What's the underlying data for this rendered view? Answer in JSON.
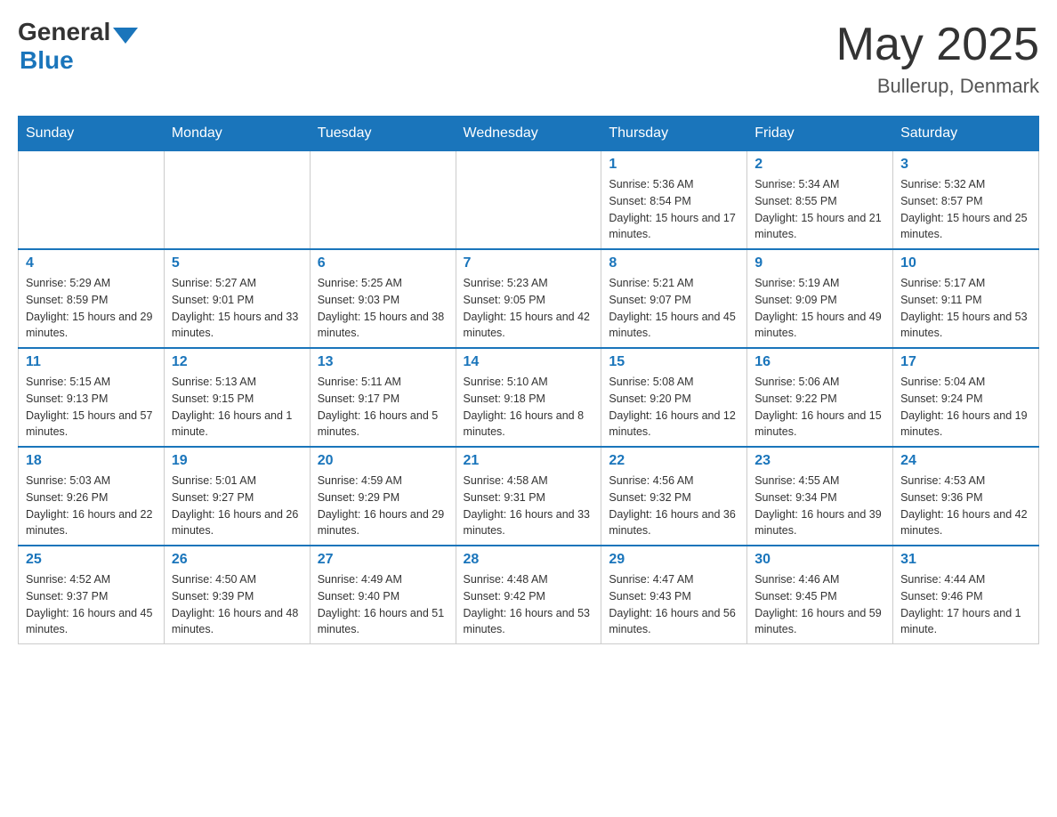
{
  "header": {
    "logo_general": "General",
    "logo_blue": "Blue",
    "month_year": "May 2025",
    "location": "Bullerup, Denmark"
  },
  "days_of_week": [
    "Sunday",
    "Monday",
    "Tuesday",
    "Wednesday",
    "Thursday",
    "Friday",
    "Saturday"
  ],
  "weeks": [
    [
      {
        "day": "",
        "info": ""
      },
      {
        "day": "",
        "info": ""
      },
      {
        "day": "",
        "info": ""
      },
      {
        "day": "",
        "info": ""
      },
      {
        "day": "1",
        "info": "Sunrise: 5:36 AM\nSunset: 8:54 PM\nDaylight: 15 hours and 17 minutes."
      },
      {
        "day": "2",
        "info": "Sunrise: 5:34 AM\nSunset: 8:55 PM\nDaylight: 15 hours and 21 minutes."
      },
      {
        "day": "3",
        "info": "Sunrise: 5:32 AM\nSunset: 8:57 PM\nDaylight: 15 hours and 25 minutes."
      }
    ],
    [
      {
        "day": "4",
        "info": "Sunrise: 5:29 AM\nSunset: 8:59 PM\nDaylight: 15 hours and 29 minutes."
      },
      {
        "day": "5",
        "info": "Sunrise: 5:27 AM\nSunset: 9:01 PM\nDaylight: 15 hours and 33 minutes."
      },
      {
        "day": "6",
        "info": "Sunrise: 5:25 AM\nSunset: 9:03 PM\nDaylight: 15 hours and 38 minutes."
      },
      {
        "day": "7",
        "info": "Sunrise: 5:23 AM\nSunset: 9:05 PM\nDaylight: 15 hours and 42 minutes."
      },
      {
        "day": "8",
        "info": "Sunrise: 5:21 AM\nSunset: 9:07 PM\nDaylight: 15 hours and 45 minutes."
      },
      {
        "day": "9",
        "info": "Sunrise: 5:19 AM\nSunset: 9:09 PM\nDaylight: 15 hours and 49 minutes."
      },
      {
        "day": "10",
        "info": "Sunrise: 5:17 AM\nSunset: 9:11 PM\nDaylight: 15 hours and 53 minutes."
      }
    ],
    [
      {
        "day": "11",
        "info": "Sunrise: 5:15 AM\nSunset: 9:13 PM\nDaylight: 15 hours and 57 minutes."
      },
      {
        "day": "12",
        "info": "Sunrise: 5:13 AM\nSunset: 9:15 PM\nDaylight: 16 hours and 1 minute."
      },
      {
        "day": "13",
        "info": "Sunrise: 5:11 AM\nSunset: 9:17 PM\nDaylight: 16 hours and 5 minutes."
      },
      {
        "day": "14",
        "info": "Sunrise: 5:10 AM\nSunset: 9:18 PM\nDaylight: 16 hours and 8 minutes."
      },
      {
        "day": "15",
        "info": "Sunrise: 5:08 AM\nSunset: 9:20 PM\nDaylight: 16 hours and 12 minutes."
      },
      {
        "day": "16",
        "info": "Sunrise: 5:06 AM\nSunset: 9:22 PM\nDaylight: 16 hours and 15 minutes."
      },
      {
        "day": "17",
        "info": "Sunrise: 5:04 AM\nSunset: 9:24 PM\nDaylight: 16 hours and 19 minutes."
      }
    ],
    [
      {
        "day": "18",
        "info": "Sunrise: 5:03 AM\nSunset: 9:26 PM\nDaylight: 16 hours and 22 minutes."
      },
      {
        "day": "19",
        "info": "Sunrise: 5:01 AM\nSunset: 9:27 PM\nDaylight: 16 hours and 26 minutes."
      },
      {
        "day": "20",
        "info": "Sunrise: 4:59 AM\nSunset: 9:29 PM\nDaylight: 16 hours and 29 minutes."
      },
      {
        "day": "21",
        "info": "Sunrise: 4:58 AM\nSunset: 9:31 PM\nDaylight: 16 hours and 33 minutes."
      },
      {
        "day": "22",
        "info": "Sunrise: 4:56 AM\nSunset: 9:32 PM\nDaylight: 16 hours and 36 minutes."
      },
      {
        "day": "23",
        "info": "Sunrise: 4:55 AM\nSunset: 9:34 PM\nDaylight: 16 hours and 39 minutes."
      },
      {
        "day": "24",
        "info": "Sunrise: 4:53 AM\nSunset: 9:36 PM\nDaylight: 16 hours and 42 minutes."
      }
    ],
    [
      {
        "day": "25",
        "info": "Sunrise: 4:52 AM\nSunset: 9:37 PM\nDaylight: 16 hours and 45 minutes."
      },
      {
        "day": "26",
        "info": "Sunrise: 4:50 AM\nSunset: 9:39 PM\nDaylight: 16 hours and 48 minutes."
      },
      {
        "day": "27",
        "info": "Sunrise: 4:49 AM\nSunset: 9:40 PM\nDaylight: 16 hours and 51 minutes."
      },
      {
        "day": "28",
        "info": "Sunrise: 4:48 AM\nSunset: 9:42 PM\nDaylight: 16 hours and 53 minutes."
      },
      {
        "day": "29",
        "info": "Sunrise: 4:47 AM\nSunset: 9:43 PM\nDaylight: 16 hours and 56 minutes."
      },
      {
        "day": "30",
        "info": "Sunrise: 4:46 AM\nSunset: 9:45 PM\nDaylight: 16 hours and 59 minutes."
      },
      {
        "day": "31",
        "info": "Sunrise: 4:44 AM\nSunset: 9:46 PM\nDaylight: 17 hours and 1 minute."
      }
    ]
  ]
}
